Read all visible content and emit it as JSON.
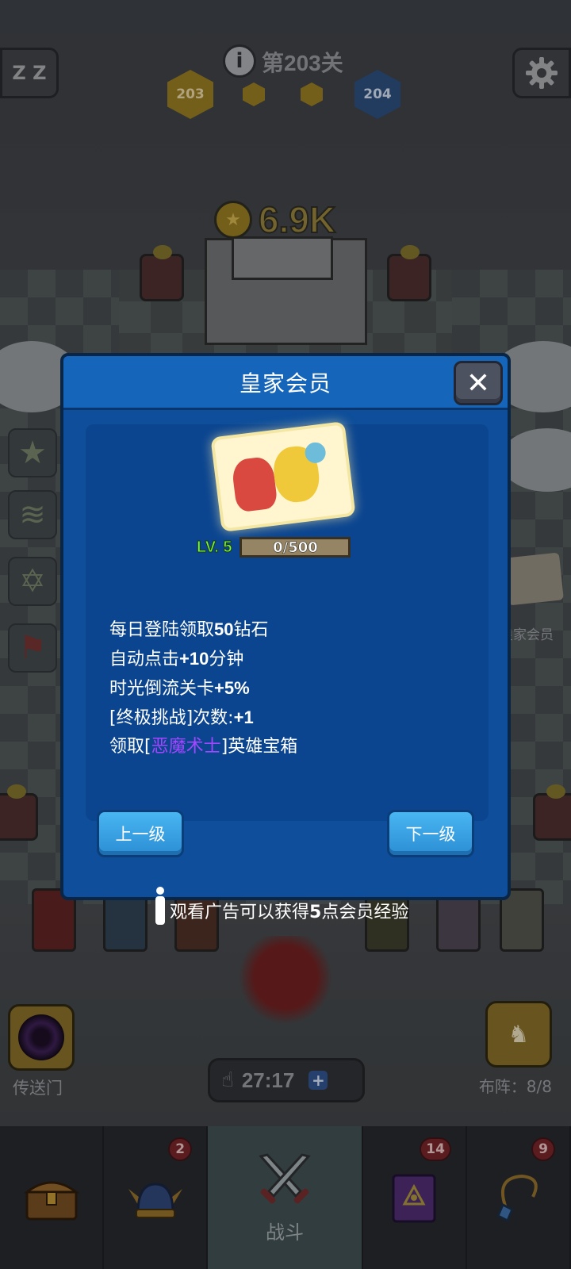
{
  "hud": {
    "sleep_label": "Z Z",
    "level_title": "第203关",
    "info_glyph": "i",
    "current_stage": "203",
    "next_stage": "204",
    "coins": "6.9K"
  },
  "side": {
    "royal_card_label": "皇家会员",
    "portal_label": "传送门",
    "formation_label": "布阵：8/8",
    "timer": "27:17",
    "timer_plus": "+"
  },
  "modal": {
    "title": "皇家会员",
    "close_glyph": "✕",
    "level_label": "LV. 5",
    "progress_text": "0/500",
    "progress_fraction": 0.0,
    "benefits": {
      "b1_pre": "每日登陆领取",
      "b1_num": "50",
      "b1_post": "钻石",
      "b2_pre": "自动点击",
      "b2_num": "+10",
      "b2_post": "分钟",
      "b3_pre": "时光倒流关卡",
      "b3_num": "+5%",
      "b4_pre": "[终极挑战]次数:",
      "b4_num": "+1",
      "b5_pre": "领取[",
      "b5_hero": "恶魔术士",
      "b5_post": "]英雄宝箱"
    },
    "prev_button": "上一级",
    "next_button": "下一级"
  },
  "ad_hint": {
    "pre": "观看广告可以获得",
    "num": "5",
    "post": "点会员经验"
  },
  "nav": {
    "items": [
      {
        "name": "chest",
        "icon": "treasure-chest-icon",
        "badge": ""
      },
      {
        "name": "heroes",
        "icon": "viking-helmet-icon",
        "badge": "2"
      },
      {
        "name": "battle",
        "icon": "crossed-swords-icon",
        "label": "战斗",
        "badge": ""
      },
      {
        "name": "spellbook",
        "icon": "spellbook-icon",
        "badge": "14"
      },
      {
        "name": "amulet",
        "icon": "amulet-icon",
        "badge": "9"
      }
    ]
  },
  "colors": {
    "modal_bg": "#0e4e9a",
    "modal_header": "#1566bb",
    "button_blue": "#2b8ed4",
    "level_green": "#7bf94a",
    "hero_purple": "#a445ff"
  }
}
